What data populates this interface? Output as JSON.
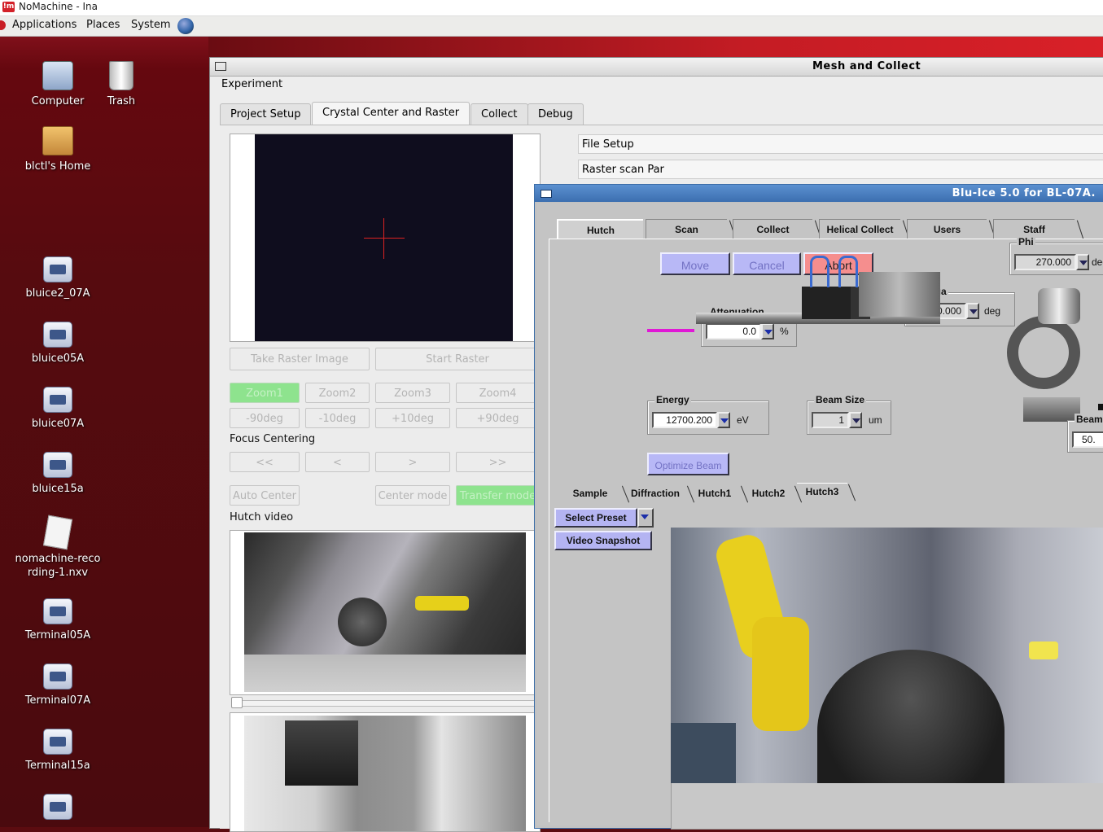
{
  "nomachine": {
    "title": "NoMachine - Ina"
  },
  "panel": {
    "applications": "Applications",
    "places": "Places",
    "system": "System"
  },
  "desktop": {
    "icons": [
      {
        "label": "Computer",
        "icon": "computer-icon"
      },
      {
        "label": "Trash",
        "icon": "trash-icon"
      },
      {
        "label": "blctl's Home",
        "icon": "home-folder-icon"
      },
      {
        "label": "bluice2_07A",
        "icon": "terminal-launcher-icon"
      },
      {
        "label": "bluice05A",
        "icon": "terminal-launcher-icon"
      },
      {
        "label": "bluice07A",
        "icon": "terminal-launcher-icon"
      },
      {
        "label": "bluice15a",
        "icon": "terminal-launcher-icon"
      },
      {
        "label": "nomachine-recording-1.nxv",
        "icon": "document-icon"
      },
      {
        "label": "Terminal05A",
        "icon": "terminal-launcher-icon"
      },
      {
        "label": "Terminal07A",
        "icon": "terminal-launcher-icon"
      },
      {
        "label": "Terminal15a",
        "icon": "terminal-launcher-icon"
      }
    ]
  },
  "mesh": {
    "title": "Mesh and Collect",
    "menu": "Experiment",
    "tabs": [
      "Project Setup",
      "Crystal Center and Raster",
      "Collect",
      "Debug"
    ],
    "active_tab": "Crystal Center and Raster",
    "buttons": {
      "take_raster": "Take Raster Image",
      "start_raster": "Start Raster",
      "zoom1": "Zoom1",
      "zoom2": "Zoom2",
      "zoom3": "Zoom3",
      "zoom4": "Zoom4",
      "minus90": "-90deg",
      "minus10": "-10deg",
      "plus10": "+10deg",
      "plus90": "+90deg",
      "ff_back": "<<",
      "back": "<",
      "fwd": ">",
      "ff_fwd": ">>",
      "auto_center": "Auto Center",
      "center_mode": "Center mode",
      "transfer_mode": "Transfer mode"
    },
    "focus_centering": "Focus Centering",
    "hutch_video": "Hutch video",
    "file_setup": "File Setup",
    "raster_scan_par": "Raster scan Par"
  },
  "bluice": {
    "title": "Blu-Ice 5.0 for BL-07A.",
    "tabs": [
      "Hutch",
      "Scan",
      "Collect",
      "Helical Collect",
      "Users",
      "Staff"
    ],
    "active_tab": "Hutch",
    "move": "Move",
    "cancel": "Cancel",
    "abort": "Abort",
    "phi": {
      "label": "Phi",
      "value": "270.000",
      "unit": "deg"
    },
    "omega": {
      "label": "Omega",
      "value": "0.000",
      "unit": "deg"
    },
    "attenuation": {
      "label": "Attenuation",
      "value": "0.0",
      "unit": "%"
    },
    "energy": {
      "label": "Energy",
      "value": "12700.200",
      "unit": "eV"
    },
    "beam_size": {
      "label": "Beam Size",
      "value": "1",
      "unit": "um"
    },
    "beam_partial": {
      "label": "Beam",
      "value": "50."
    },
    "optimize_beam": "Optimize Beam",
    "subtabs": [
      "Sample",
      "Diffraction",
      "Hutch1",
      "Hutch2",
      "Hutch3"
    ],
    "active_subtab": "Hutch3",
    "select_preset": "Select Preset",
    "video_snapshot": "Video Snapshot",
    "colors": {
      "abort": "#f58e8e",
      "purple_btn": "#b8b8f6",
      "title_bar": "#3c6fb0"
    }
  }
}
